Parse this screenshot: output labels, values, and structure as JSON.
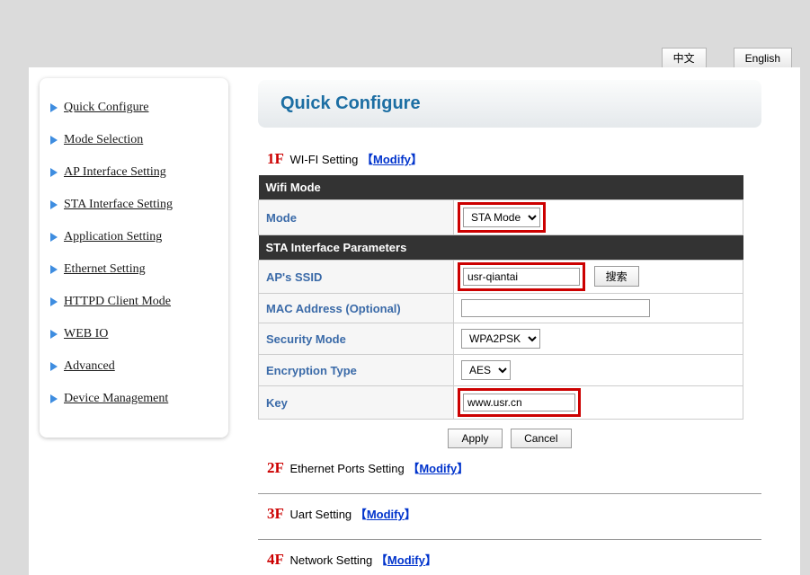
{
  "lang": {
    "cn": "中文",
    "en": "English"
  },
  "sidebar": {
    "items": [
      "Quick Configure",
      "Mode Selection",
      "AP Interface Setting",
      "STA Interface Setting",
      "Application Setting",
      "Ethernet Setting",
      "HTTPD Client Mode",
      "WEB IO",
      "Advanced",
      "Device Management"
    ]
  },
  "title": "Quick Configure",
  "sections": {
    "s1": {
      "num": "1F",
      "label": "WI-FI Setting",
      "modify": "Modify"
    },
    "s2": {
      "num": "2F",
      "label": "Ethernet Ports Setting",
      "modify": "Modify"
    },
    "s3": {
      "num": "3F",
      "label": "Uart Setting",
      "modify": "Modify"
    },
    "s4": {
      "num": "4F",
      "label": "Network Setting",
      "modify": "Modify"
    }
  },
  "wifi": {
    "header_mode": "Wifi Mode",
    "mode_label": "Mode",
    "mode_value": "STA Mode",
    "header_sta": "STA Interface Parameters",
    "ssid_label": "AP's SSID",
    "ssid_value": "usr-qiantai",
    "search": "搜索",
    "mac_label": "MAC Address (Optional)",
    "mac_value": "",
    "secmode_label": "Security Mode",
    "secmode_value": "WPA2PSK",
    "enc_label": "Encryption Type",
    "enc_value": "AES",
    "key_label": "Key",
    "key_value": "www.usr.cn"
  },
  "buttons": {
    "apply": "Apply",
    "cancel": "Cancel"
  }
}
